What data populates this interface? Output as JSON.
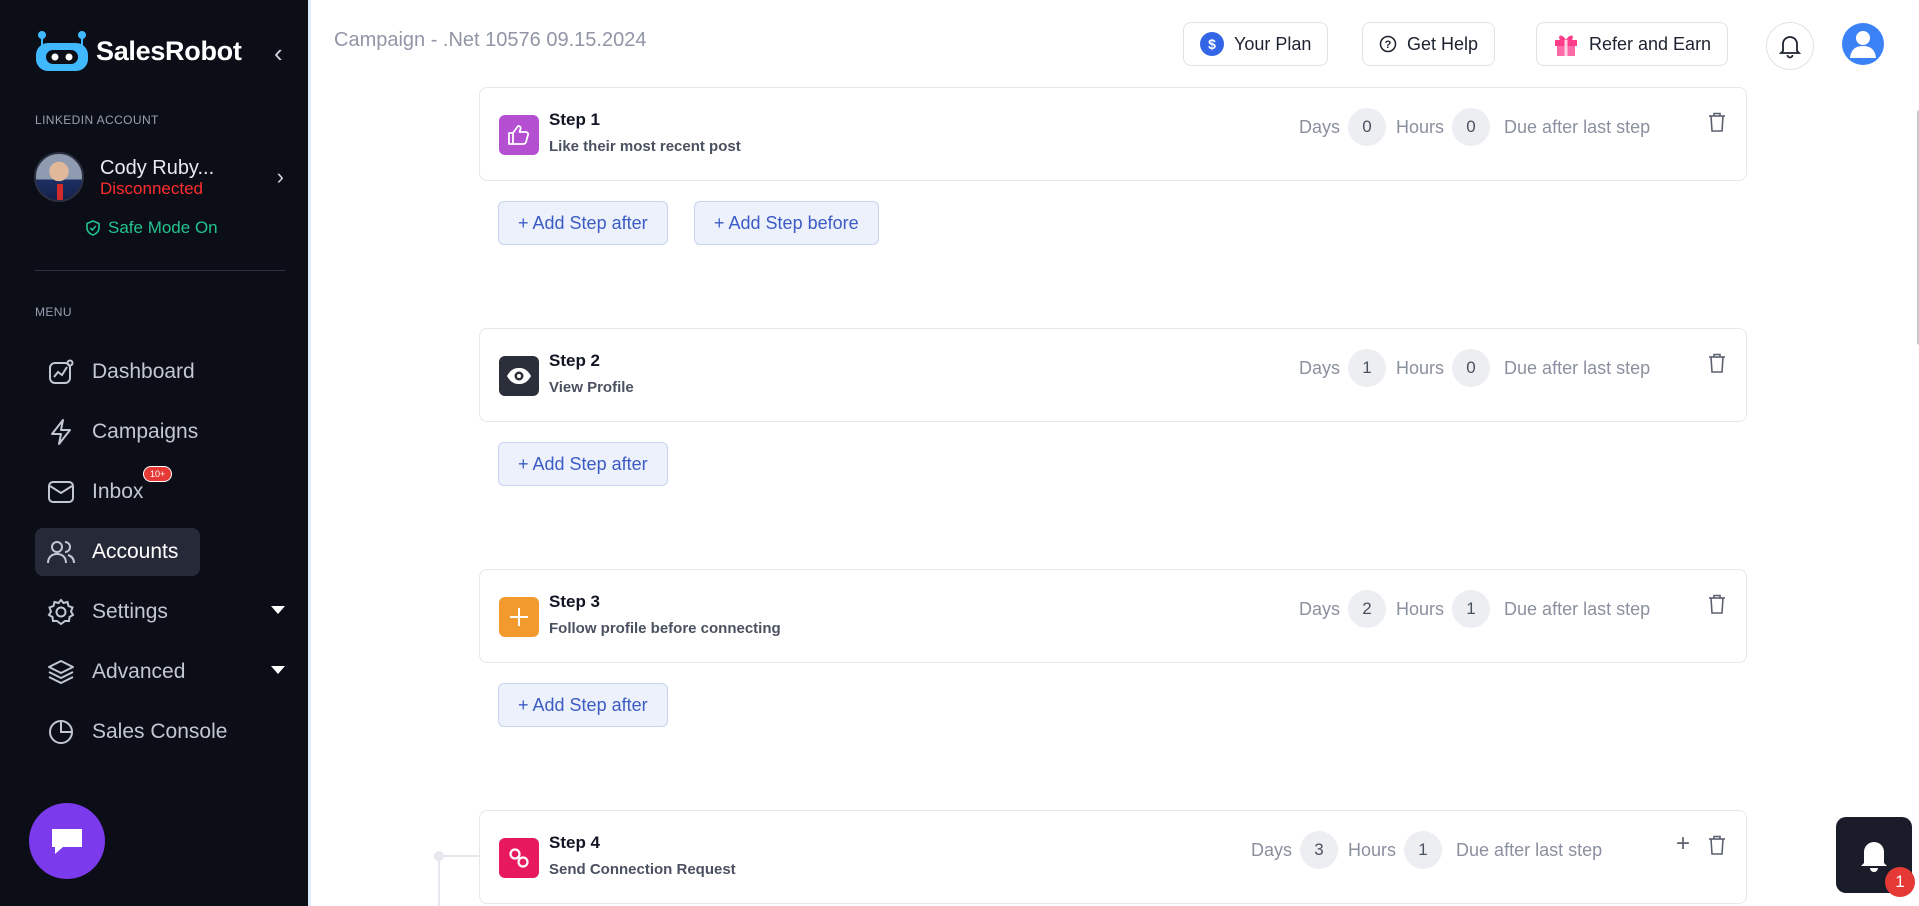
{
  "brand": {
    "name": "SalesRobot",
    "collapse_icon": "chevron-left-icon"
  },
  "linkedin": {
    "section_label": "LINKEDIN ACCOUNT",
    "name": "Cody Ruby...",
    "status": "Disconnected",
    "safe_mode": "Safe Mode On"
  },
  "menu": {
    "label": "MENU",
    "items": [
      {
        "label": "Dashboard",
        "icon": "dashboard-chart-icon"
      },
      {
        "label": "Campaigns",
        "icon": "lightning-icon"
      },
      {
        "label": "Inbox",
        "icon": "mail-icon",
        "badge": "10+"
      },
      {
        "label": "Accounts",
        "icon": "users-icon",
        "active": true
      },
      {
        "label": "Settings",
        "icon": "gear-icon",
        "has_dropdown": true
      },
      {
        "label": "Advanced",
        "icon": "layers-icon",
        "has_dropdown": true
      },
      {
        "label": "Sales Console",
        "icon": "pie-chart-icon"
      }
    ]
  },
  "header": {
    "campaign_title": "Campaign - .Net 10576 09.15.2024",
    "your_plan": "Your Plan",
    "get_help": "Get Help",
    "refer_and_earn": "Refer and Earn"
  },
  "steps": [
    {
      "title": "Step 1",
      "desc": "Like their most recent post",
      "days": "0",
      "hours": "0",
      "icon": "thumbs-up-icon",
      "color": "#b44fd1"
    },
    {
      "title": "Step 2",
      "desc": "View Profile",
      "days": "1",
      "hours": "0",
      "icon": "eye-icon",
      "color": "#2b2f3a"
    },
    {
      "title": "Step 3",
      "desc": "Follow profile before connecting",
      "days": "2",
      "hours": "1",
      "icon": "plus-icon",
      "color": "#f29a2e"
    },
    {
      "title": "Step 4",
      "desc": "Send Connection Request",
      "days": "3",
      "hours": "1",
      "icon": "link-icon",
      "color": "#e8185f"
    }
  ],
  "labels": {
    "days": "Days",
    "hours": "Hours",
    "due": "Due after last step",
    "add_after": "+ Add Step after",
    "add_before": "+ Add Step before"
  },
  "notifications": {
    "count": "1"
  }
}
